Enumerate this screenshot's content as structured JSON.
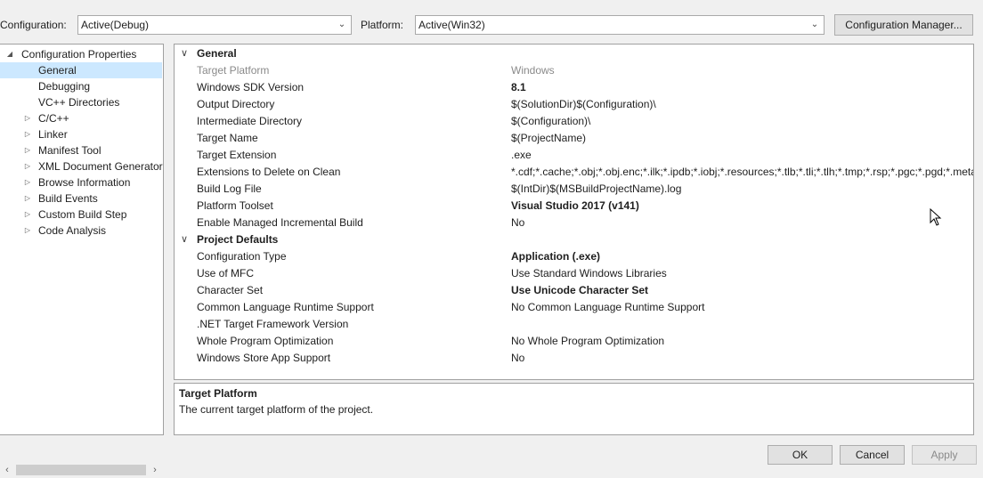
{
  "config_bar": {
    "configuration_label": "Configuration:",
    "configuration_value": "Active(Debug)",
    "platform_label": "Platform:",
    "platform_value": "Active(Win32)",
    "config_manager_button": "Configuration Manager..."
  },
  "tree": {
    "root_label": "Configuration Properties",
    "items": [
      {
        "label": "General",
        "selected": true,
        "expandable": false
      },
      {
        "label": "Debugging",
        "expandable": false
      },
      {
        "label": "VC++ Directories",
        "expandable": false
      },
      {
        "label": "C/C++",
        "expandable": true
      },
      {
        "label": "Linker",
        "expandable": true
      },
      {
        "label": "Manifest Tool",
        "expandable": true
      },
      {
        "label": "XML Document Generator",
        "expandable": true
      },
      {
        "label": "Browse Information",
        "expandable": true
      },
      {
        "label": "Build Events",
        "expandable": true
      },
      {
        "label": "Custom Build Step",
        "expandable": true
      },
      {
        "label": "Code Analysis",
        "expandable": true
      }
    ]
  },
  "grid": {
    "categories": [
      {
        "name": "General",
        "rows": [
          {
            "name": "Target Platform",
            "value": "Windows",
            "dim": true
          },
          {
            "name": "Windows SDK Version",
            "value": "8.1",
            "bold": true
          },
          {
            "name": "Output Directory",
            "value": "$(SolutionDir)$(Configuration)\\"
          },
          {
            "name": "Intermediate Directory",
            "value": "$(Configuration)\\"
          },
          {
            "name": "Target Name",
            "value": "$(ProjectName)"
          },
          {
            "name": "Target Extension",
            "value": ".exe"
          },
          {
            "name": "Extensions to Delete on Clean",
            "value": "*.cdf;*.cache;*.obj;*.obj.enc;*.ilk;*.ipdb;*.iobj;*.resources;*.tlb;*.tli;*.tlh;*.tmp;*.rsp;*.pgc;*.pgd;*.meta"
          },
          {
            "name": "Build Log File",
            "value": "$(IntDir)$(MSBuildProjectName).log"
          },
          {
            "name": "Platform Toolset",
            "value": "Visual Studio 2017 (v141)",
            "bold": true
          },
          {
            "name": "Enable Managed Incremental Build",
            "value": "No"
          }
        ]
      },
      {
        "name": "Project Defaults",
        "rows": [
          {
            "name": "Configuration Type",
            "value": "Application (.exe)",
            "bold": true
          },
          {
            "name": "Use of MFC",
            "value": "Use Standard Windows Libraries"
          },
          {
            "name": "Character Set",
            "value": "Use Unicode Character Set",
            "bold": true
          },
          {
            "name": "Common Language Runtime Support",
            "value": "No Common Language Runtime Support"
          },
          {
            "name": ".NET Target Framework Version",
            "value": ""
          },
          {
            "name": "Whole Program Optimization",
            "value": "No Whole Program Optimization"
          },
          {
            "name": "Windows Store App Support",
            "value": "No"
          }
        ]
      }
    ]
  },
  "description": {
    "title": "Target Platform",
    "text": "The current target platform of the project."
  },
  "buttons": {
    "ok": "OK",
    "cancel": "Cancel",
    "apply": "Apply"
  },
  "icons": {
    "dropdown": "chevron-down-icon",
    "expand": "triangle-right-icon",
    "collapse": "triangle-down-icon",
    "cursor": "mouse-pointer-icon"
  },
  "colors": {
    "selection": "#cce8ff",
    "background": "#f0f0f0",
    "border": "#a0a0a0"
  }
}
